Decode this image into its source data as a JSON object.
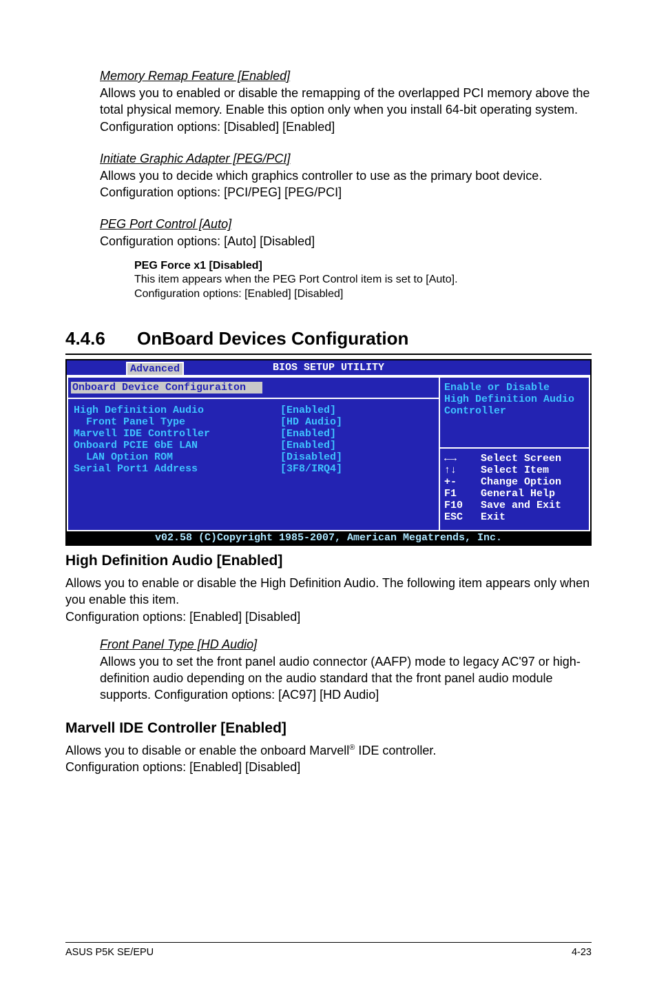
{
  "sec1": {
    "title": "Memory Remap Feature [Enabled]",
    "body": "Allows you to enabled or disable the remapping of the overlapped PCI memory above the total physical memory. Enable this option only when you install 64-bit operating system. Configuration options: [Disabled] [Enabled]"
  },
  "sec2": {
    "title": "Initiate Graphic Adapter [PEG/PCI]",
    "body": "Allows you to decide which graphics controller to use as the primary boot device. Configuration options: [PCI/PEG] [PEG/PCI]"
  },
  "sec3": {
    "title": "PEG Port Control [Auto]",
    "body": "Configuration options: [Auto] [Disabled]"
  },
  "pegforce": {
    "title": "PEG Force x1 [Disabled]",
    "l1": "This item appears when the PEG Port Control item is set to [Auto].",
    "l2": "Configuration options: [Enabled] [Disabled]"
  },
  "section": {
    "num": "4.4.6",
    "title": "OnBoard Devices Configuration"
  },
  "bios": {
    "title": "BIOS SETUP UTILITY",
    "tab": "Advanced",
    "panel_title": "Onboard Device Configuraiton",
    "rows": [
      {
        "label": "High Definition Audio",
        "value": "[Enabled]"
      },
      {
        "label": "  Front Panel Type",
        "value": "[HD Audio]"
      },
      {
        "label": "Marvell IDE Controller",
        "value": "[Enabled]"
      },
      {
        "label": "Onboard PCIE GbE LAN",
        "value": "[Enabled]"
      },
      {
        "label": "  LAN Option ROM",
        "value": "[Disabled]"
      },
      {
        "label": "",
        "value": ""
      },
      {
        "label": "Serial Port1 Address",
        "value": "[3F8/IRQ4]"
      }
    ],
    "help": {
      "l1": "Enable or Disable",
      "l2": "High Definition Audio",
      "l3": "Controller"
    },
    "keys": [
      {
        "k": "←→",
        "t": "Select Screen"
      },
      {
        "k": "↑↓",
        "t": "Select Item"
      },
      {
        "k": "+-",
        "t": "Change Option"
      },
      {
        "k": "F1",
        "t": "General Help"
      },
      {
        "k": "F10",
        "t": "Save and Exit"
      },
      {
        "k": "ESC",
        "t": "Exit"
      }
    ],
    "footer": "v02.58 (C)Copyright 1985-2007, American Megatrends, Inc."
  },
  "hda": {
    "title": "High Definition Audio [Enabled]",
    "l1": "Allows you to enable or disable the High Definition Audio. The following item appears only when you enable this item.",
    "l2": "Configuration options: [Enabled] [Disabled]"
  },
  "fpt": {
    "title": "Front Panel Type [HD Audio]",
    "body": "Allows you to set the front panel audio connector (AAFP) mode to legacy AC'97 or high-definition audio depending on the audio standard that the front panel audio module supports. Configuration options: [AC97] [HD Audio]"
  },
  "marvell": {
    "title": "Marvell IDE Controller [Enabled]",
    "l1a": "Allows you to disable or enable the onboard Marvell",
    "l1b": " IDE controller.",
    "l2": "Configuration options: [Enabled] [Disabled]"
  },
  "footer": {
    "left": "ASUS P5K SE/EPU",
    "right": "4-23"
  }
}
